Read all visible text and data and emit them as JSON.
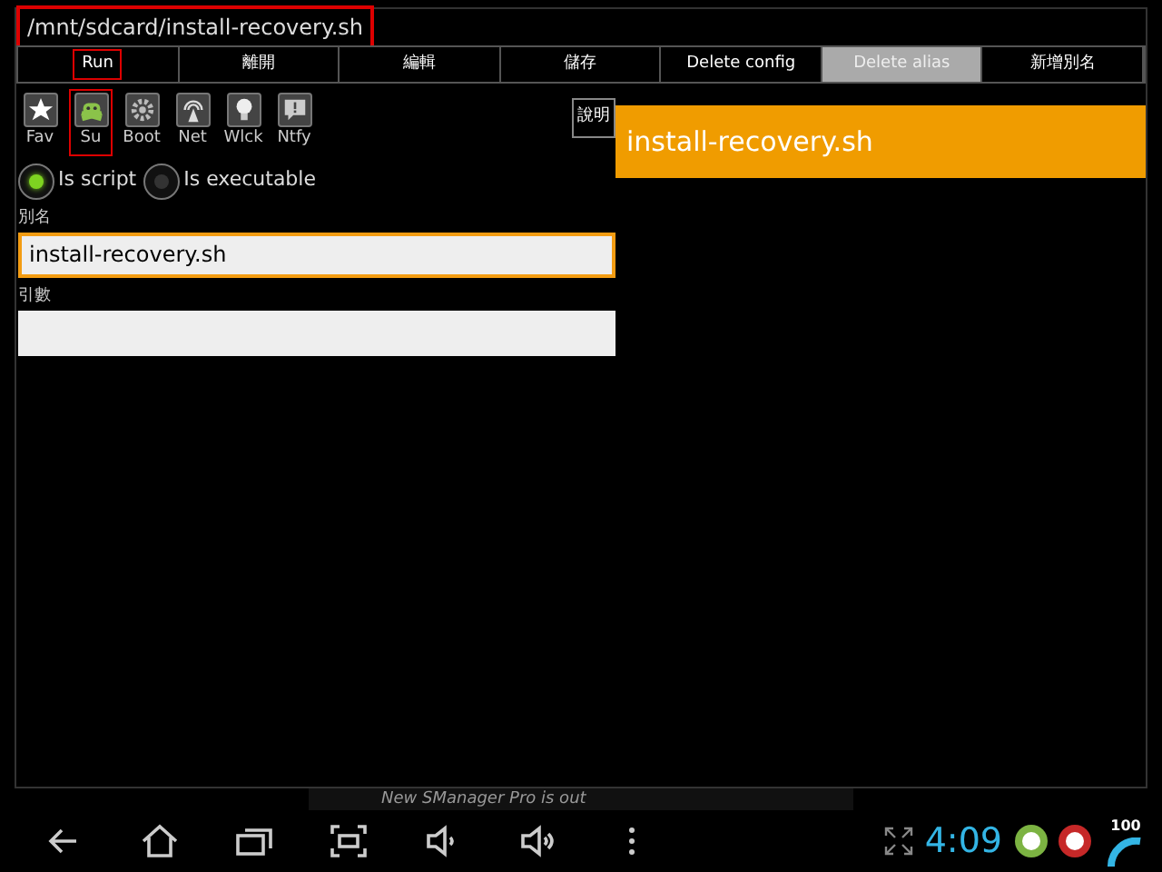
{
  "dialog": {
    "path": "/mnt/sdcard/install-recovery.sh",
    "tabs": [
      {
        "label": "Run",
        "selected": false,
        "highlighted": true
      },
      {
        "label": "離開",
        "selected": false,
        "highlighted": false
      },
      {
        "label": "編輯",
        "selected": false,
        "highlighted": false
      },
      {
        "label": "儲存",
        "selected": false,
        "highlighted": false
      },
      {
        "label": "Delete config",
        "selected": false,
        "highlighted": false
      },
      {
        "label": "Delete alias",
        "selected": true,
        "highlighted": false
      },
      {
        "label": "新增別名",
        "selected": false,
        "highlighted": false
      }
    ],
    "toggles": [
      {
        "kind": "star",
        "label": "Fav",
        "selected": false
      },
      {
        "kind": "android",
        "label": "Su",
        "selected": true
      },
      {
        "kind": "gear",
        "label": "Boot",
        "selected": false
      },
      {
        "kind": "antenna",
        "label": "Net",
        "selected": false
      },
      {
        "kind": "bulb",
        "label": "Wlck",
        "selected": false
      },
      {
        "kind": "notify",
        "label": "Ntfy",
        "selected": false
      }
    ],
    "help_button": "說明",
    "radios": [
      {
        "label": "Is script",
        "selected": true
      },
      {
        "label": "Is executable",
        "selected": false
      }
    ],
    "alias_label": "別名",
    "alias_value": "install-recovery.sh",
    "args_label": "引數",
    "alias_list": [
      {
        "label": "install-recovery.sh",
        "selected": true
      }
    ]
  },
  "notification": "New SManager Pro is out",
  "status_bar": {
    "time": "4:09",
    "battery": "100"
  }
}
